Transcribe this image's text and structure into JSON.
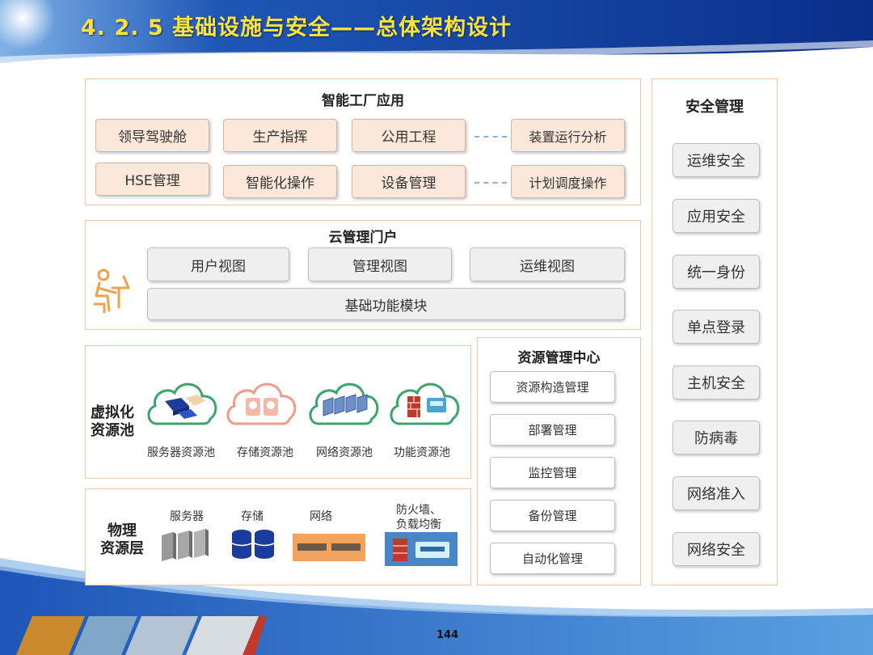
{
  "title": "4. 2. 5  基础设施与安全——总体架构设计",
  "page_number": "144",
  "smart_factory": {
    "title": "智能工厂应用",
    "row1": [
      "领导驾驶舱",
      "生产指挥",
      "公用工程",
      "装置运行分析"
    ],
    "row2": [
      "HSE管理",
      "智能化操作",
      "设备管理",
      "计划调度操作"
    ]
  },
  "cloud_portal": {
    "title": "云管理门户",
    "views": [
      "用户视图",
      "管理视图",
      "运维视图"
    ],
    "base": "基础功能模块"
  },
  "virtual_pool": {
    "label_line1": "虚拟化",
    "label_line2": "资源池",
    "items": [
      "服务器资源池",
      "存储资源池",
      "网络资源池",
      "功能资源池"
    ]
  },
  "physical": {
    "label_line1": "物理",
    "label_line2": "资源层",
    "items": [
      "服务器",
      "存储",
      "网络"
    ],
    "firewall_line1": "防火墙、",
    "firewall_line2": "负载均衡"
  },
  "resource_center": {
    "title": "资源管理中心",
    "items": [
      "资源构造管理",
      "部署管理",
      "监控管理",
      "备份管理",
      "自动化管理"
    ]
  },
  "security": {
    "title": "安全管理",
    "items": [
      "运维安全",
      "应用安全",
      "统一身份",
      "单点登录",
      "主机安全",
      "防病毒",
      "网络准入",
      "网络安全"
    ]
  },
  "colors": {
    "panel_border": "#efc7a7",
    "orange_button": "#fbe8da",
    "title_text": "#ffe23a",
    "header_blue": "#0e3d97",
    "cloud_green": "#3aa56b"
  }
}
